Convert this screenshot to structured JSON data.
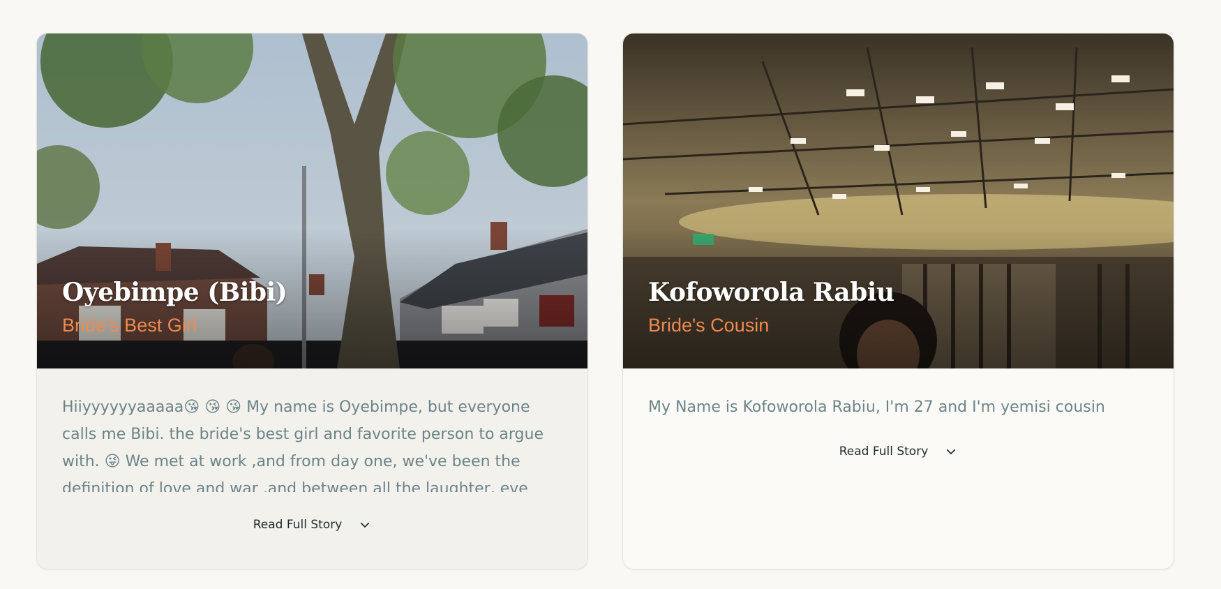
{
  "cards": [
    {
      "name": "Oyebimpe (Bibi)",
      "role": "Bride's Best Girl",
      "story": "Hiiyyyyyyaaaaa😘 😘 😘 My name is Oyebimpe, but everyone calls me Bibi. the bride's best girl and favorite person to argue with. 😜 We met at work ,and from day one, we've been the definition of love and war ,and between all the laughter, eve",
      "read_more": "Read Full Story",
      "photo": "person-under-tree-street-photo",
      "chevron_icon": "chevron-down-icon"
    },
    {
      "name": "Kofoworola Rabiu",
      "role": "Bride's Cousin",
      "story": "My Name is Kofoworola Rabiu, I'm 27 and I'm yemisi cousin",
      "read_more": "Read Full Story",
      "photo": "person-in-lobby-photo",
      "chevron_icon": "chevron-down-icon"
    }
  ],
  "colors": {
    "page_bg": "#f9f8f4",
    "role_accent": "#ee8a4f",
    "story_text": "#6b8489",
    "name_text": "#ffffff"
  }
}
